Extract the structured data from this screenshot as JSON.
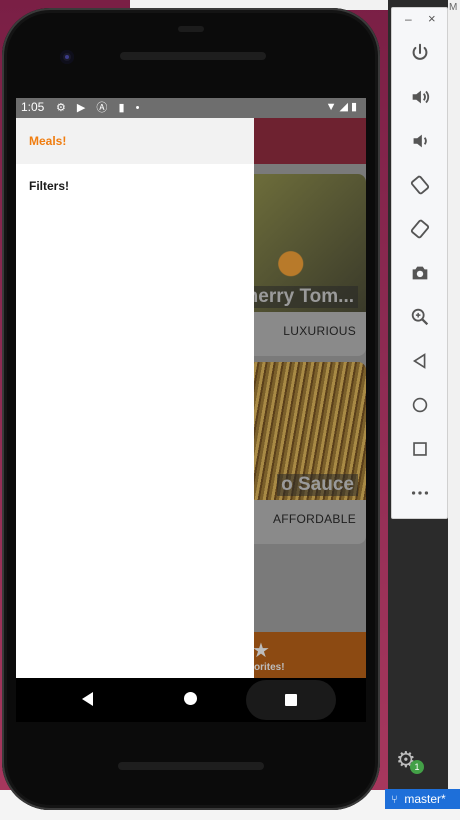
{
  "host": {
    "edge_letter": "M",
    "git_branch": "master*",
    "notification_count": "1"
  },
  "status_bar": {
    "time": "1:05",
    "left_icons": "⚙ ▶ Ⓐ ▮ •",
    "right_icons": "▼◢▮"
  },
  "drawer": {
    "items": [
      {
        "label": "Meals!",
        "active": true
      },
      {
        "label": "Filters!",
        "active": false
      }
    ]
  },
  "meals": [
    {
      "title": "herry Tom...",
      "meta": "LUXURIOUS"
    },
    {
      "title": "o Sauce",
      "meta": "AFFORDABLE"
    }
  ],
  "tab_bar": {
    "label": "orites!"
  },
  "emulator_toolbar": {
    "minimize": "–",
    "close": "×",
    "buttons": [
      "power-icon",
      "volume-up-icon",
      "volume-down-icon",
      "rotate-left-icon",
      "rotate-right-icon",
      "camera-icon",
      "zoom-icon",
      "back-icon",
      "home-icon",
      "overview-icon",
      "more-icon"
    ]
  },
  "colors": {
    "accent": "#f07d10",
    "header": "#6e2230",
    "tab_bar": "#8c4a12",
    "git_status": "#1e6fd9"
  }
}
